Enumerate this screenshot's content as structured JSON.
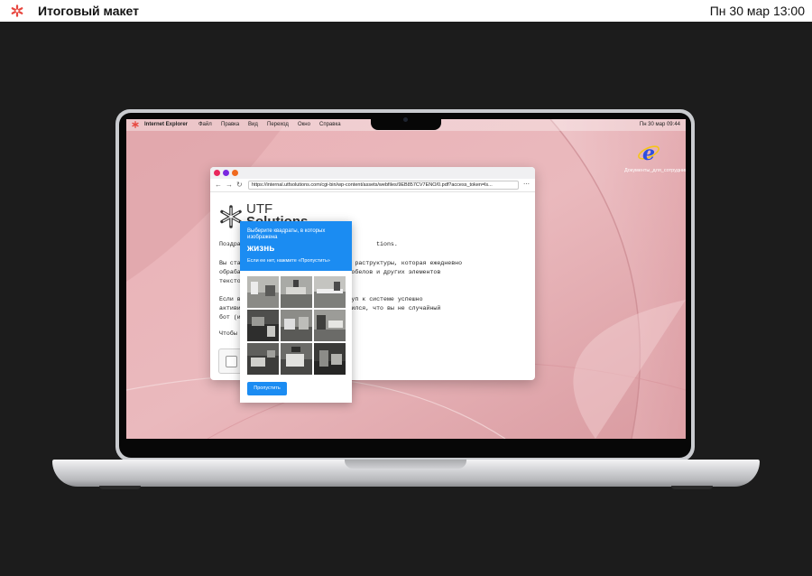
{
  "outer": {
    "title": "Итоговый макет",
    "clock": "Пн 30 мар 13:00",
    "accent": "#e8473f"
  },
  "menubar": {
    "app": "Internet Explorer",
    "items": [
      "Файл",
      "Правка",
      "Вид",
      "Переход",
      "Окно",
      "Справка"
    ],
    "clock": "Пн 30 мар 09:44"
  },
  "desktop_icon": {
    "icon": "internet-explorer-icon",
    "label": "Документы_для_сотрудников.html"
  },
  "browser": {
    "url": "https://internal.utfsolutions.com/cgi-bin/wp-content/assets/webfiles/9EB857CV7ENO/0.pdf?access_token=ls...",
    "brand_top": "UTF",
    "brand_bottom": "Solutions",
    "paragraphs": [
      "Поздрав                                     tions.",
      "Вы стал                               раструктуры, которая ежедневно\nобрабат                            пробелов и других элементов\nтекстов",
      "Если вы                      ваш доступ к системе успешно\nактивир                          убедился, что вы не случайный\nбот (ил",
      "Чтобы п"
    ]
  },
  "captcha": {
    "instruction": "Выберите квадраты, в которых изображена",
    "target": "жизнь",
    "hint": "Если ее нет, нажмите «Пропустить»",
    "skip_label": "Пропустить",
    "accent": "#1b8cf2"
  }
}
